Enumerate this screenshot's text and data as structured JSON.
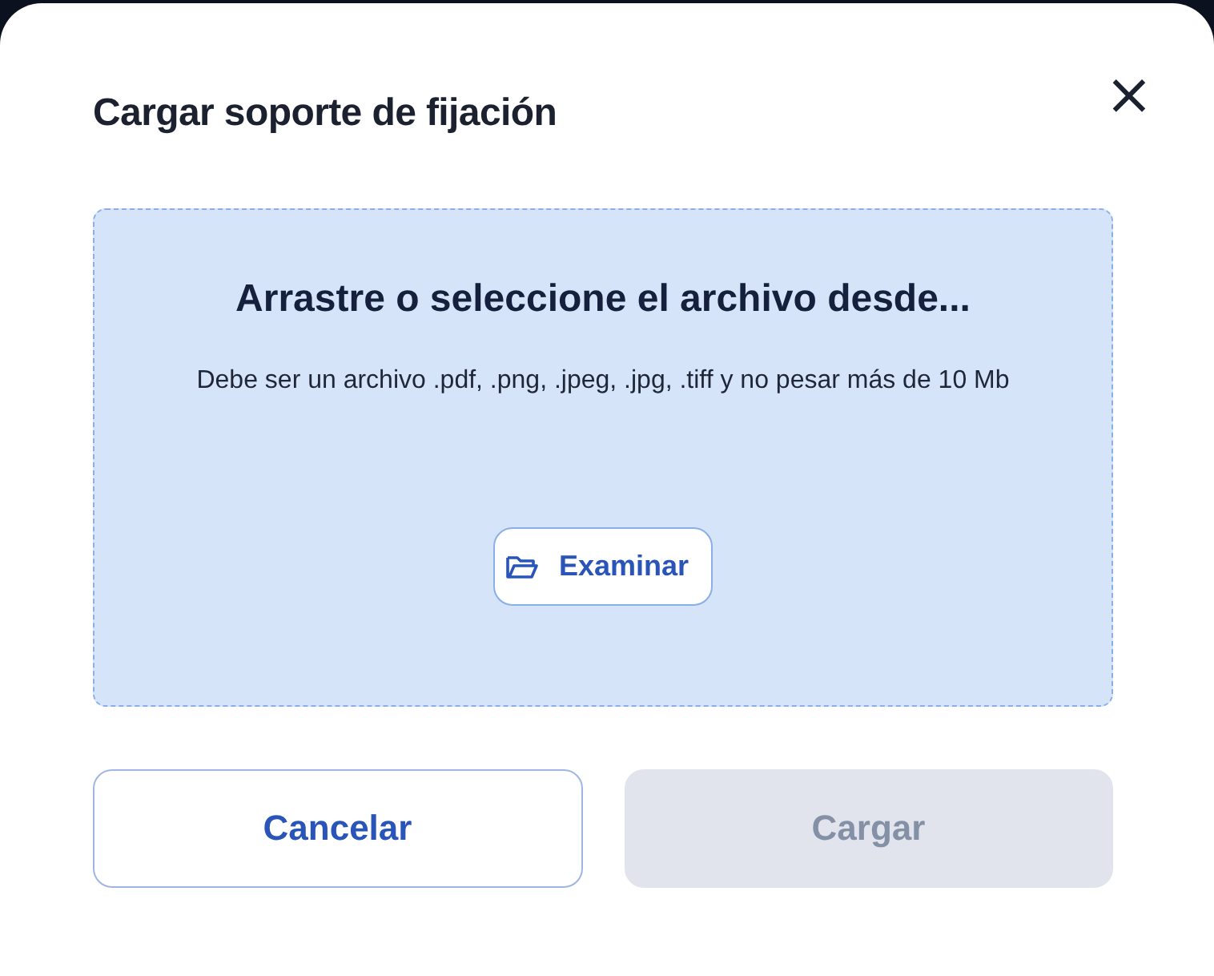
{
  "dialog": {
    "title": "Cargar soporte de fijación",
    "close_label": "×"
  },
  "dropzone": {
    "heading": "Arrastre o seleccione el archivo desde...",
    "description": "Debe ser un archivo .pdf, .png, .jpeg, .jpg, .tiff y no pesar más de 10 Mb",
    "browse_button": "Examinar"
  },
  "buttons": [
    {
      "label": "Cancelar",
      "disabled": false
    },
    {
      "label": "Cargar",
      "disabled": true
    }
  ]
}
